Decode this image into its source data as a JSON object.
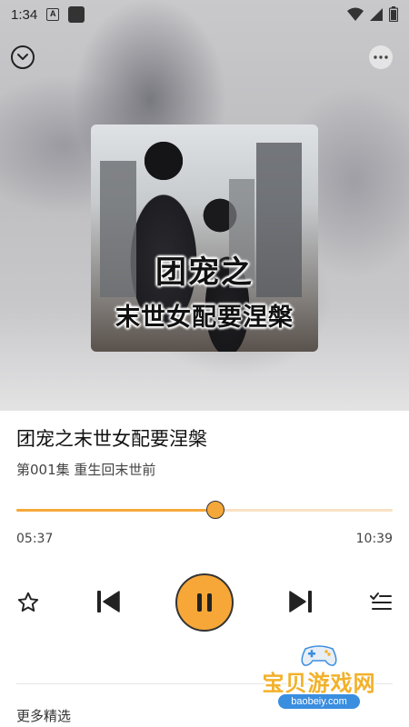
{
  "status_bar": {
    "time": "1:34"
  },
  "icons": {
    "collapse": "chevron-down-icon",
    "more": "more-horizontal-icon",
    "favorite": "star-icon",
    "previous": "skip-previous-icon",
    "play_pause": "pause-icon",
    "next": "skip-next-icon",
    "playlist": "playlist-icon",
    "wifi": "wifi-icon",
    "signal": "signal-icon",
    "battery": "battery-icon"
  },
  "cover": {
    "line1": "团宠之",
    "line2": "末世女配要涅槃"
  },
  "track": {
    "title": "团宠之末世女配要涅槃",
    "episode": "第001集 重生回末世前"
  },
  "progress": {
    "elapsed": "05:37",
    "total": "10:39",
    "fraction": 0.529
  },
  "section": {
    "more_picks": "更多精选"
  },
  "watermark": {
    "text": "宝贝游戏网",
    "url": "baobeiy.com"
  },
  "colors": {
    "accent": "#f5a83a",
    "track_bg": "#f9e1c4"
  }
}
